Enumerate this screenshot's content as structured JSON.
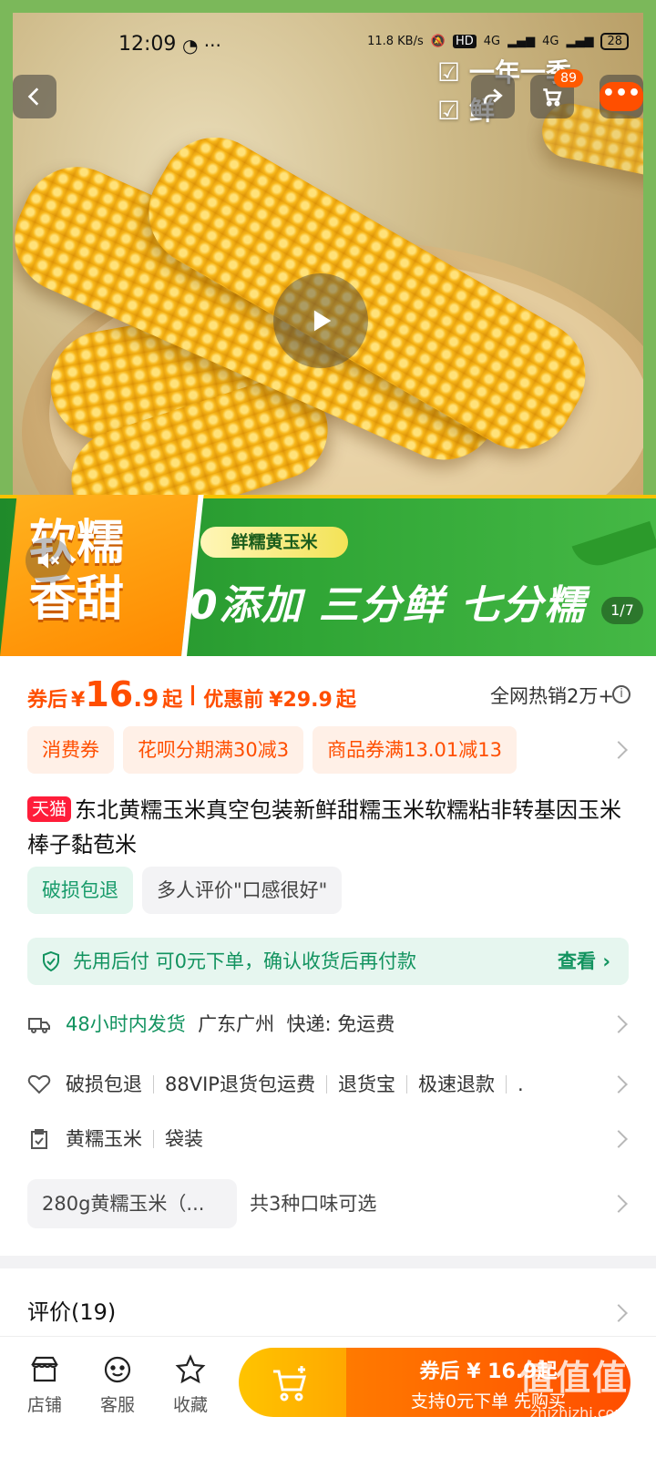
{
  "status": {
    "time": "12:09",
    "speed": "11.8 KB/s",
    "hd": "HD",
    "net1": "4G",
    "net2": "4G",
    "battery": "28"
  },
  "hero": {
    "checks": [
      "一年一季",
      "鲜"
    ],
    "cart_count": "89",
    "slogan_line1": "软糯",
    "slogan_line2": "香甜",
    "tag": "鲜糯黄玉米",
    "headline": "0添加 三分鲜 七分糯",
    "pager": "1/7"
  },
  "price": {
    "after_label": "券后",
    "currency": "¥",
    "after_int": "16",
    "after_dec": ".9",
    "qi": "起",
    "before_label": "优惠前",
    "before_value": "¥29.9",
    "before_qi": "起",
    "sales": "全网热销2万+"
  },
  "coupons": [
    "消费券",
    "花呗分期满30减3",
    "商品券满13.01减13"
  ],
  "product": {
    "badge": "天猫",
    "title": "东北黄糯玉米真空包装新鲜甜糯玉米软糯粘非转基因玉米棒子黏苞米"
  },
  "chips": [
    "破损包退",
    "多人评价\"口感很好\""
  ],
  "pay": {
    "text": "先用后付 可0元下单，确认收货后再付款",
    "action": "查看 ›"
  },
  "shipping": {
    "highlight": "48小时内发货",
    "location": "广东广州",
    "express": "快递: 免运费"
  },
  "services": [
    "破损包退",
    "88VIP退货包运费",
    "退货宝",
    "极速退款",
    "."
  ],
  "specs": [
    "黄糯玉米",
    "袋装"
  ],
  "variant": {
    "selected": "280g黄糯玉米（...",
    "more": "共3种口味可选"
  },
  "review": {
    "label": "评价(19)"
  },
  "bottom": {
    "tabs": [
      "店铺",
      "客服",
      "收藏"
    ],
    "buy_line1": "券后 ¥ 16.9起",
    "buy_line2": "支持0元下单 先购买"
  },
  "watermark": {
    "main": "值值值",
    "sub": "zhizhizhi.com"
  }
}
